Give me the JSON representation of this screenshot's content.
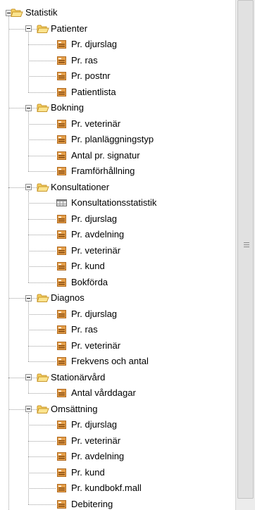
{
  "tree": {
    "root_label": "Statistik",
    "groups": [
      {
        "label": "Patienter",
        "items": [
          {
            "label": "Pr. djurslag",
            "icon": "report-icon"
          },
          {
            "label": "Pr. ras",
            "icon": "report-icon"
          },
          {
            "label": "Pr. postnr",
            "icon": "report-icon"
          },
          {
            "label": "Patientlista",
            "icon": "report-icon"
          }
        ]
      },
      {
        "label": "Bokning",
        "items": [
          {
            "label": "Pr. veterinär",
            "icon": "report-icon"
          },
          {
            "label": "Pr. planläggningstyp",
            "icon": "report-icon"
          },
          {
            "label": "Antal pr. signatur",
            "icon": "report-icon"
          },
          {
            "label": "Framförhållning",
            "icon": "report-icon"
          }
        ]
      },
      {
        "label": "Konsultationer",
        "items": [
          {
            "label": "Konsultationsstatistik",
            "icon": "table-icon"
          },
          {
            "label": "Pr. djurslag",
            "icon": "report-icon"
          },
          {
            "label": "Pr. avdelning",
            "icon": "report-icon"
          },
          {
            "label": "Pr. veterinär",
            "icon": "report-icon"
          },
          {
            "label": "Pr. kund",
            "icon": "report-icon"
          },
          {
            "label": "Bokförda",
            "icon": "report-icon"
          }
        ]
      },
      {
        "label": "Diagnos",
        "items": [
          {
            "label": "Pr. djurslag",
            "icon": "report-icon"
          },
          {
            "label": "Pr. ras",
            "icon": "report-icon"
          },
          {
            "label": "Pr. veterinär",
            "icon": "report-icon"
          },
          {
            "label": "Frekvens och antal",
            "icon": "report-icon"
          }
        ]
      },
      {
        "label": "Stationärvård",
        "items": [
          {
            "label": "Antal vårddagar",
            "icon": "report-icon"
          }
        ]
      },
      {
        "label": "Omsättning",
        "items": [
          {
            "label": "Pr. djurslag",
            "icon": "report-icon"
          },
          {
            "label": "Pr. veterinär",
            "icon": "report-icon"
          },
          {
            "label": "Pr. avdelning",
            "icon": "report-icon"
          },
          {
            "label": "Pr. kund",
            "icon": "report-icon"
          },
          {
            "label": "Pr. kundbokf.mall",
            "icon": "report-icon"
          },
          {
            "label": "Debitering",
            "icon": "report-icon"
          }
        ]
      }
    ]
  },
  "colors": {
    "folder_fill": "#f5cf5e",
    "folder_stroke": "#c8972c",
    "report_icon_fill": "#e6a04a",
    "report_icon_stroke": "#b06a20",
    "guide_lines": "#a0a0a0"
  }
}
